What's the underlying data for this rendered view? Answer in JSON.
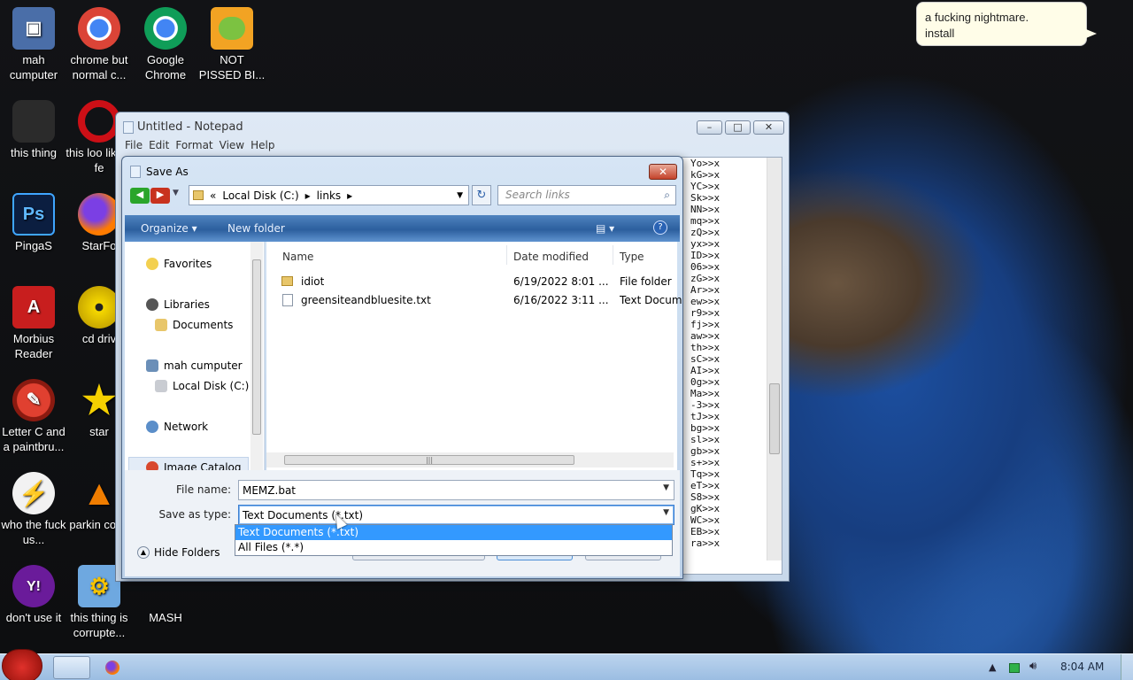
{
  "speech_bubble": {
    "line1": "a fucking nightmare.",
    "line2": "install"
  },
  "desktop_icons": [
    {
      "label": "mah cumputer",
      "color": "#4a6ea8",
      "glyph": "▣"
    },
    {
      "label": "chrome but normal c...",
      "color": "#db4437",
      "glyph": "◉"
    },
    {
      "label": "Google Chrome",
      "color": "#db4437",
      "glyph": "◉"
    },
    {
      "label": "NOT PISSED BI...",
      "color": "#f2a323",
      "glyph": "●"
    },
    {
      "label": "this thing",
      "color": "#2b2b2b",
      "glyph": "▮"
    },
    {
      "label": "this loo like a fe",
      "color": "#cc0f16",
      "glyph": "O"
    },
    {
      "label": "PingaS",
      "color": "#1f3b7a",
      "glyph": "Ps"
    },
    {
      "label": "StarFo",
      "color": "#e66000",
      "glyph": "◐"
    },
    {
      "label": "Morbius Reader",
      "color": "#d42020",
      "glyph": "A"
    },
    {
      "label": "cd driv",
      "color": "#e8c800",
      "glyph": "◎"
    },
    {
      "label": "Letter C and a paintbru...",
      "color": "#c0392b",
      "glyph": "✎"
    },
    {
      "label": "star",
      "color": "#f5d000",
      "glyph": "★"
    },
    {
      "label": "who the fuck us...",
      "color": "#e8e8e8",
      "glyph": "⚡"
    },
    {
      "label": "parkin cone",
      "color": "#f07d00",
      "glyph": "▲"
    },
    {
      "label": "don't use it",
      "color": "#7b1fa2",
      "glyph": "Y!"
    },
    {
      "label": "this thing is corrupte...",
      "color": "#6ea8e0",
      "glyph": "⚙"
    },
    {
      "label": "MASH",
      "color": "#2a4a8a",
      "glyph": "●"
    }
  ],
  "notepad": {
    "title": "Untitled - Notepad",
    "menu": [
      "File",
      "Edit",
      "Format",
      "View",
      "Help"
    ],
    "lines": [
      "Yo>>x",
      "kG>>x",
      "YC>>x",
      "Sk>>x",
      "NN>>x",
      "mq>>x",
      "zQ>>x",
      "yx>>x",
      "ID>>x",
      "06>>x",
      "zG>>x",
      "Ar>>x",
      "ew>>x",
      "r9>>x",
      "fj>>x",
      "aw>>x",
      "th>>x",
      "sC>>x",
      "AI>>x",
      "0g>>x",
      "Ma>>x",
      "-3>>x",
      "tJ>>x",
      "bg>>x",
      "sl>>x",
      "gb>>x",
      "s+>>x",
      "Tq>>x",
      "eT>>x",
      "S8>>x",
      "gK>>x",
      "WC>>x",
      "EB>>x",
      "ra>>x"
    ]
  },
  "save_as": {
    "title": "Save As",
    "address_parts": [
      "«",
      "Local Disk (C:)",
      "links"
    ],
    "search_placeholder": "Search links",
    "organize_label": "Organize",
    "new_folder_label": "New folder",
    "nav": {
      "favorites": "Favorites",
      "libraries": "Libraries",
      "documents": "Documents",
      "computer": "mah cumputer",
      "local_disk": "Local Disk (C:)",
      "network": "Network",
      "image_catalog": "Image Catalog"
    },
    "columns": {
      "name": "Name",
      "date": "Date modified",
      "type": "Type"
    },
    "files": [
      {
        "name": "idiot",
        "date": "6/19/2022 8:01 ...",
        "type": "File folder"
      },
      {
        "name": "greensiteandbluesite.txt",
        "date": "6/16/2022 3:11 ...",
        "type": "Text Docum"
      }
    ],
    "file_name_label": "File name:",
    "file_name_value": "MEMZ.bat",
    "save_type_label": "Save as type:",
    "save_type_value": "Text Documents (*.txt)",
    "type_options": [
      "Text Documents (*.txt)",
      "All Files  (*.*)"
    ],
    "hide_folders_label": "Hide Folders"
  },
  "taskbar": {
    "clock": "8:04 AM"
  }
}
